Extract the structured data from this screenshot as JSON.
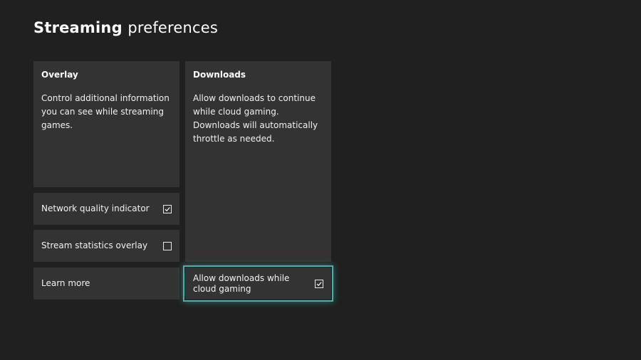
{
  "header": {
    "title_strong": "Streaming",
    "title_light": "preferences"
  },
  "overlay": {
    "heading": "Overlay",
    "description": "Control additional information you can see while streaming games.",
    "network_quality": {
      "label": "Network quality indicator",
      "checked": true
    },
    "stream_stats": {
      "label": "Stream statistics overlay",
      "checked": false
    },
    "learn_more": "Learn more"
  },
  "downloads": {
    "heading": "Downloads",
    "description": "Allow downloads to continue while cloud gaming. Downloads will automatically throttle as needed.",
    "allow_toggle": {
      "label": "Allow downloads while cloud gaming",
      "checked": true,
      "focused": true
    }
  },
  "colors": {
    "background": "#202020",
    "tile": "#333333",
    "focus_ring": "#46b2ad"
  }
}
